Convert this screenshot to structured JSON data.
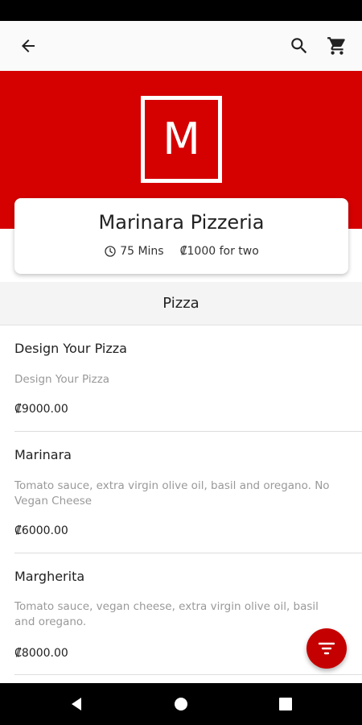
{
  "app_bar": {
    "back_icon": "arrow-back-icon",
    "search_icon": "search-icon",
    "cart_icon": "shopping-cart-icon"
  },
  "hero": {
    "logo_letter": "M",
    "accent_color": "#d50000"
  },
  "restaurant": {
    "name": "Marinara Pizzeria",
    "delivery_time": "75 Mins",
    "cost_for_two": "₡1000 for two",
    "clock_icon": "clock-icon"
  },
  "section": {
    "title": "Pizza"
  },
  "menu_items": [
    {
      "name": "Design Your Pizza",
      "description": "Design Your Pizza",
      "price": "₡9000.00"
    },
    {
      "name": "Marinara",
      "description": "Tomato sauce, extra virgin olive oil, basil and oregano. No Vegan Cheese",
      "price": "₡6000.00"
    },
    {
      "name": "Margherita",
      "description": "Tomato sauce, vegan cheese, extra virgin olive oil, basil and oregano.",
      "price": "₡8000.00"
    }
  ],
  "fab": {
    "icon": "filter-icon"
  },
  "nav_bar": {
    "back_icon": "nav-back-icon",
    "home_icon": "nav-home-icon",
    "recents_icon": "nav-recents-icon"
  }
}
